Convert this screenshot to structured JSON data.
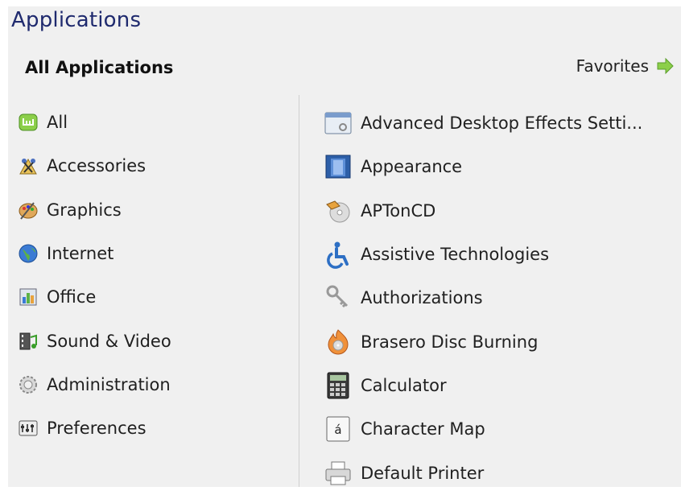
{
  "title": "Applications",
  "header": {
    "all_applications": "All Applications",
    "favorites": "Favorites"
  },
  "categories": [
    {
      "label": "All",
      "icon": "mint-logo-icon"
    },
    {
      "label": "Accessories",
      "icon": "accessories-icon"
    },
    {
      "label": "Graphics",
      "icon": "graphics-palette-icon"
    },
    {
      "label": "Internet",
      "icon": "globe-icon"
    },
    {
      "label": "Office",
      "icon": "office-icon"
    },
    {
      "label": "Sound & Video",
      "icon": "film-music-icon"
    },
    {
      "label": "Administration",
      "icon": "gear-icon"
    },
    {
      "label": "Preferences",
      "icon": "preferences-icon"
    }
  ],
  "applications": [
    {
      "label": "Advanced Desktop Effects Setti...",
      "icon": "desktop-effects-icon"
    },
    {
      "label": "Appearance",
      "icon": "appearance-icon"
    },
    {
      "label": "APTonCD",
      "icon": "aptoncd-icon"
    },
    {
      "label": "Assistive Technologies",
      "icon": "accessibility-icon"
    },
    {
      "label": "Authorizations",
      "icon": "keys-icon"
    },
    {
      "label": "Brasero Disc Burning",
      "icon": "disc-burning-icon"
    },
    {
      "label": "Calculator",
      "icon": "calculator-icon"
    },
    {
      "label": "Character Map",
      "icon": "character-map-icon"
    },
    {
      "label": "Default Printer",
      "icon": "printer-icon"
    }
  ],
  "colors": {
    "title": "#1f2a6e",
    "background": "#f0f0f0",
    "favorites_arrow": "#7cc242"
  }
}
